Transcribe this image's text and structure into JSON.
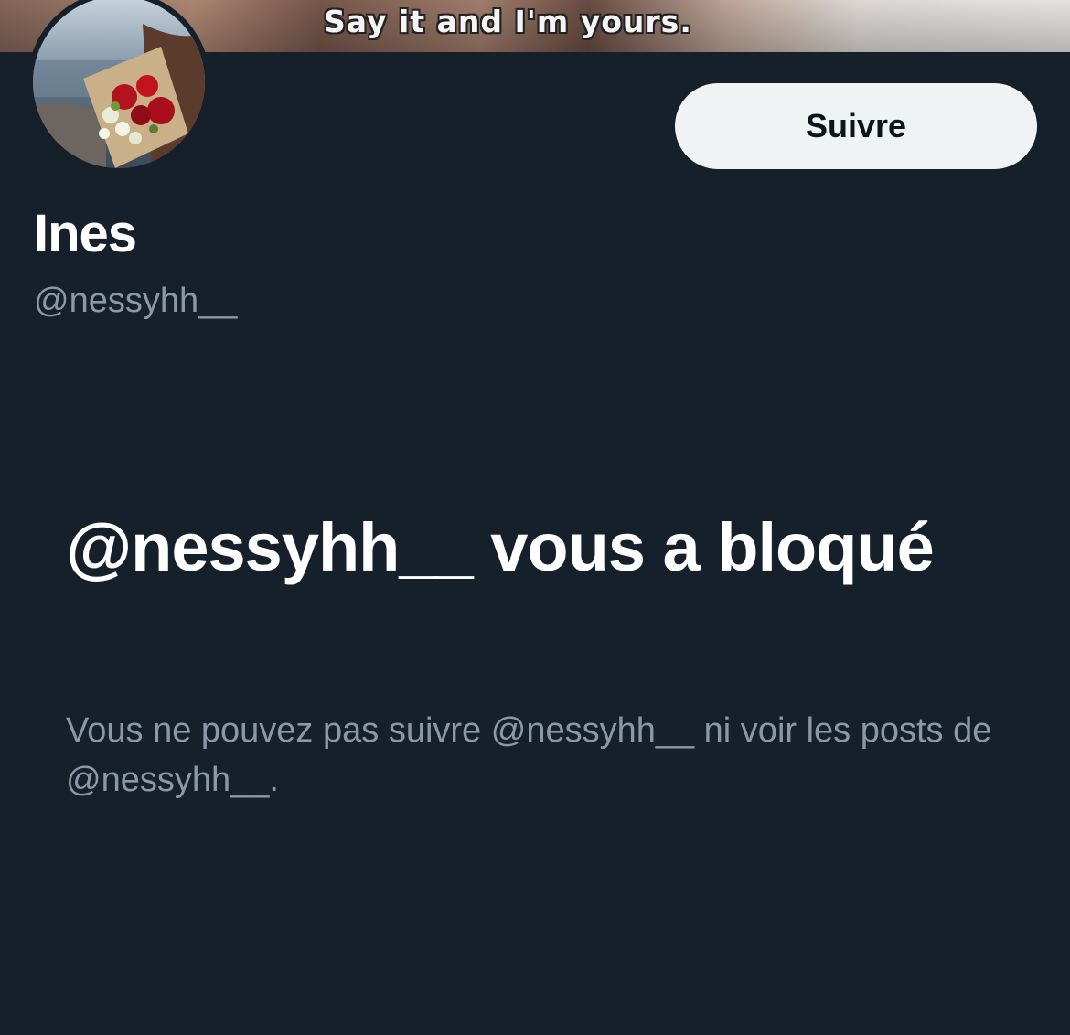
{
  "banner": {
    "caption": "Say it and I'm yours."
  },
  "profile": {
    "display_name": "Ines",
    "handle": "@nessyhh__",
    "follow_label": "Suivre"
  },
  "blocked": {
    "title": "@nessyhh__ vous a bloqué",
    "description": "Vous ne pouvez pas suivre @nessyhh__ ni voir les posts de @nessyhh__."
  },
  "colors": {
    "background": "#15202b",
    "primary_text": "#ffffff",
    "secondary_text": "#8b98a5",
    "button_bg": "#eff3f4",
    "button_text": "#0f1419"
  }
}
